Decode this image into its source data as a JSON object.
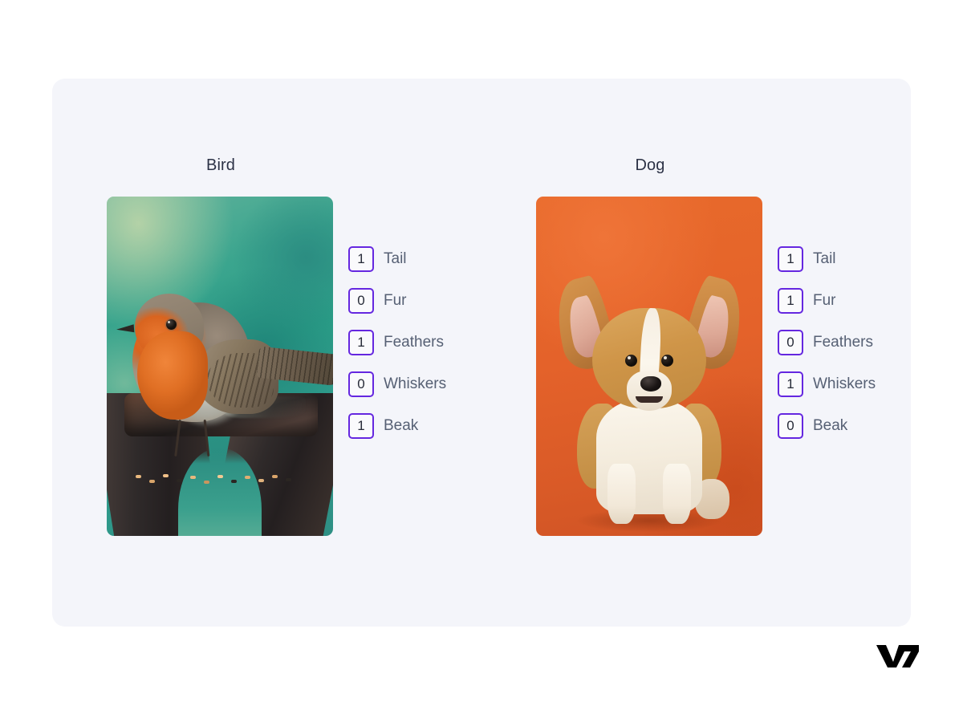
{
  "brand": {
    "logo_text": "V7",
    "logo_name": "v7-logo"
  },
  "panel": {
    "background_color": "#f4f5fa",
    "accent_color": "#6527e0",
    "title_color": "#2c3246",
    "label_color": "#566074"
  },
  "columns": [
    {
      "id": "bird",
      "title": "Bird",
      "image_name": "bird-photo",
      "image_alt": "European robin perched on a weathered tree stump with seeds, teal green background",
      "image_bg_color": "#2ba088",
      "attributes": [
        {
          "label": "Tail",
          "value": "1"
        },
        {
          "label": "Fur",
          "value": "0"
        },
        {
          "label": "Feathers",
          "value": "1"
        },
        {
          "label": "Whiskers",
          "value": "0"
        },
        {
          "label": "Beak",
          "value": "1"
        }
      ]
    },
    {
      "id": "dog",
      "title": "Dog",
      "image_name": "dog-photo",
      "image_alt": "Corgi puppy sitting against an orange background",
      "image_bg_color": "#e4622a",
      "attributes": [
        {
          "label": "Tail",
          "value": "1"
        },
        {
          "label": "Fur",
          "value": "1"
        },
        {
          "label": "Feathers",
          "value": "0"
        },
        {
          "label": "Whiskers",
          "value": "1"
        },
        {
          "label": "Beak",
          "value": "0"
        }
      ]
    }
  ]
}
